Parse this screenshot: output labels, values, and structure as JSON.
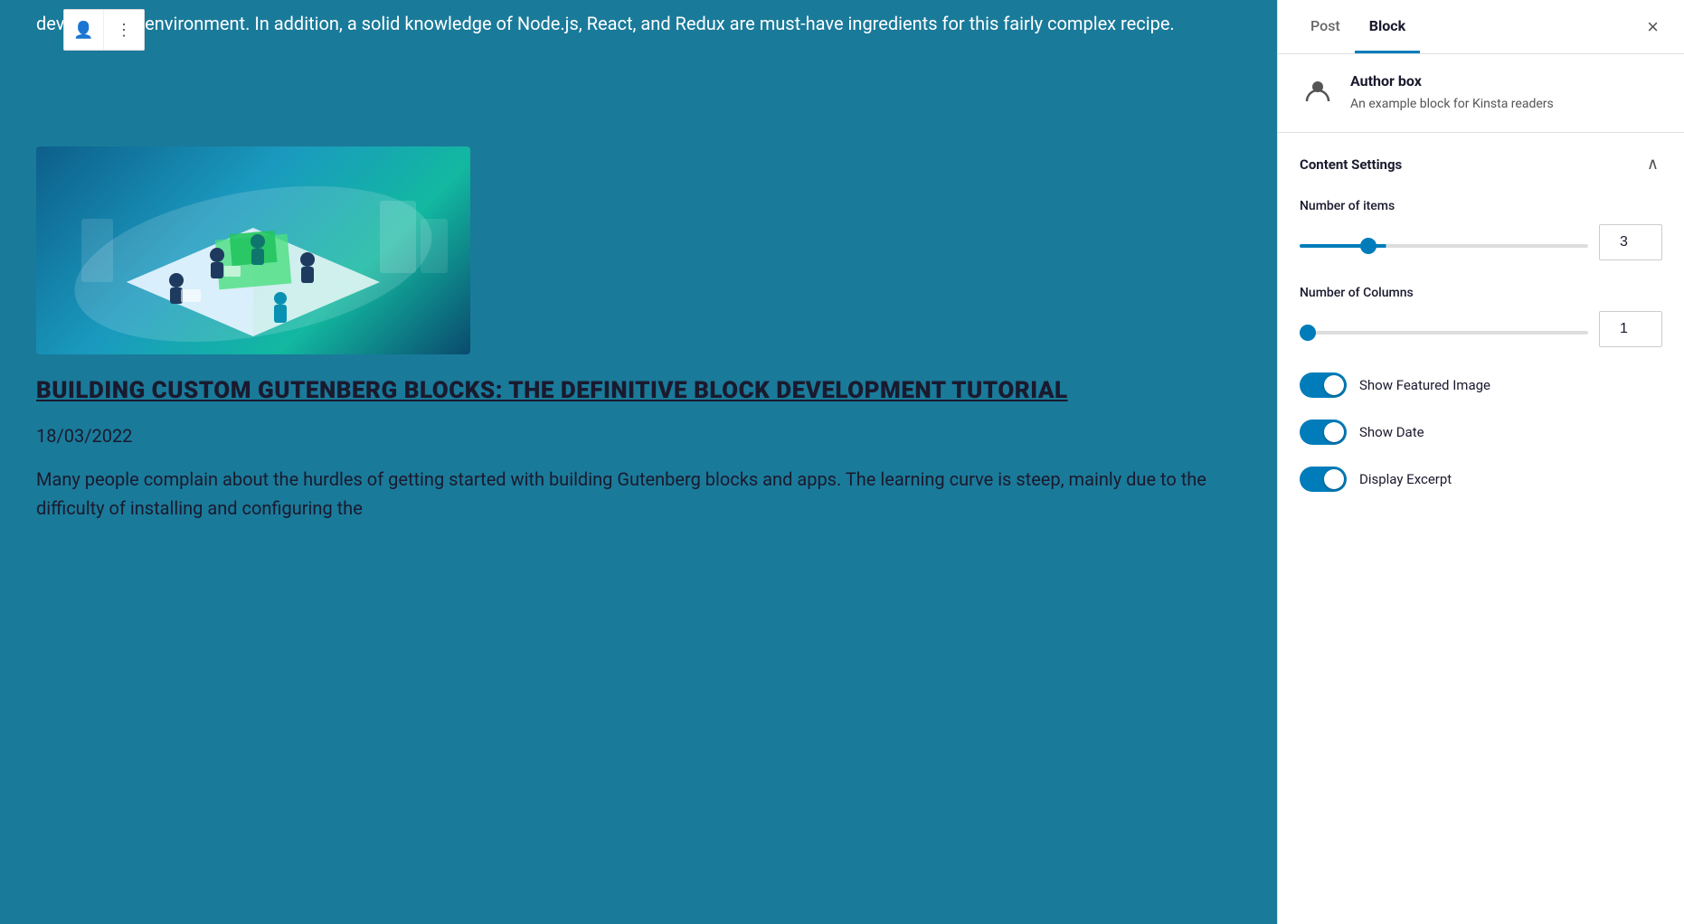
{
  "tabs": {
    "post_label": "Post",
    "block_label": "Block",
    "active": "block"
  },
  "close_button": "×",
  "block_info": {
    "name": "Author box",
    "description": "An example block for Kinsta readers"
  },
  "content_settings": {
    "title": "Content Settings",
    "number_of_items": {
      "label": "Number of items",
      "value": "3",
      "min": 1,
      "max": 10,
      "fill_percent": 30
    },
    "number_of_columns": {
      "label": "Number of Columns",
      "value": "1",
      "min": 1,
      "max": 6,
      "fill_percent": 5
    },
    "show_featured_image": {
      "label": "Show Featured Image",
      "enabled": true
    },
    "show_date": {
      "label": "Show Date",
      "enabled": true
    },
    "display_excerpt": {
      "label": "Display Excerpt",
      "enabled": true
    }
  },
  "content": {
    "intro_text": "development environment. In addition, a solid knowledge of Node.js, React, and Redux are must-have ingredients for this fairly complex recipe.",
    "post_title": "BUILDING CUSTOM GUTENBERG BLOCKS: THE DEFINITIVE BLOCK DEVELOPMENT TUTORIAL",
    "post_date": "18/03/2022",
    "post_excerpt_1": "Many people complain about the hurdles of getting started with building Gutenberg blocks and apps. The learning curve is steep, mainly due to the difficulty of installing and configuring the"
  },
  "toolbar": {
    "user_icon": "👤",
    "more_icon": "⋮"
  }
}
